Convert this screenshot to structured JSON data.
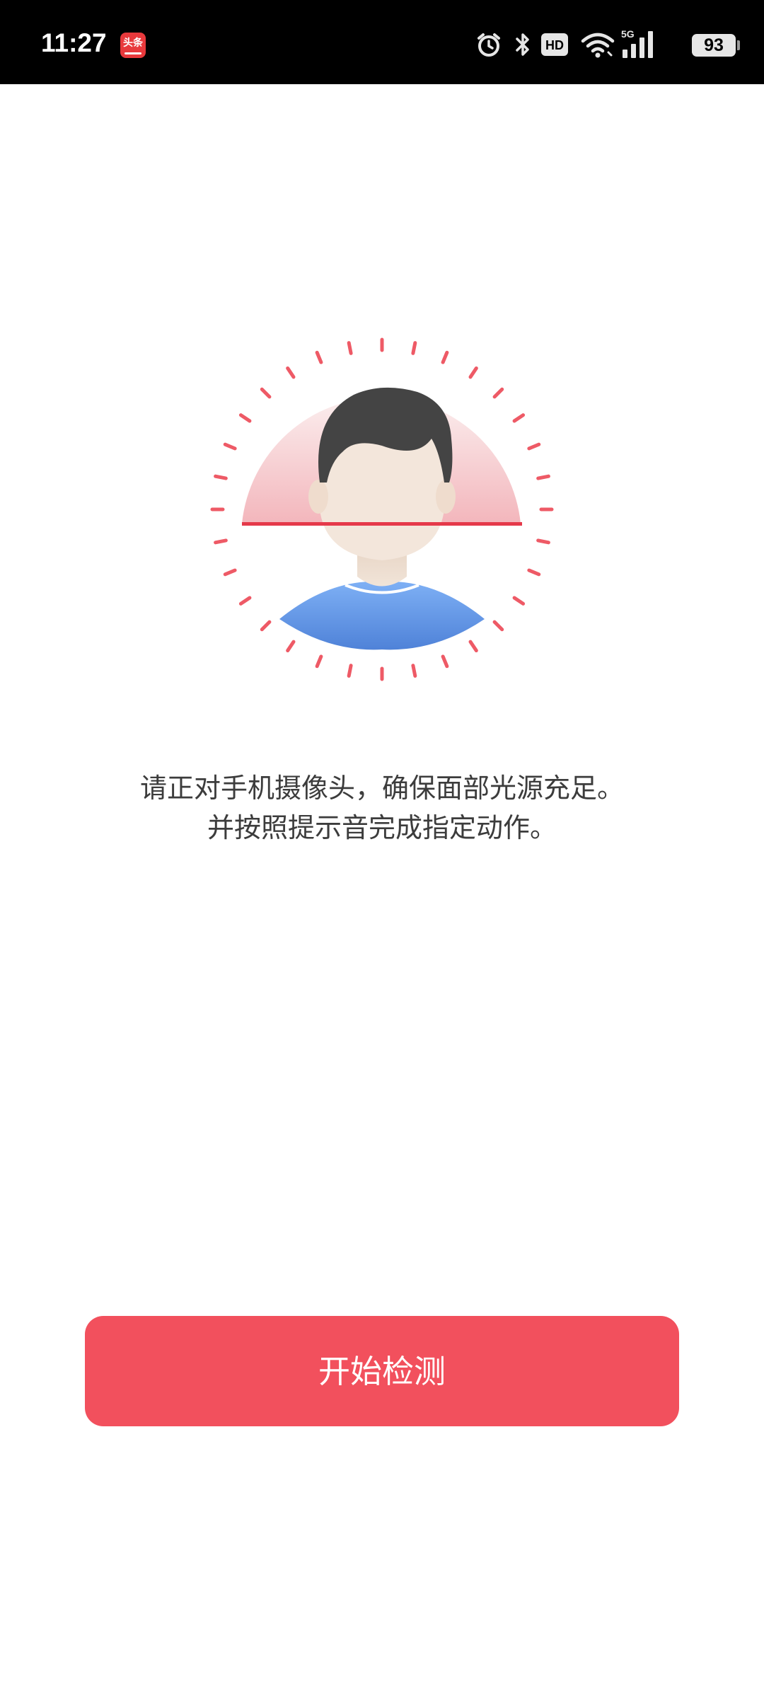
{
  "status_bar": {
    "time": "11:27",
    "app_badge": "头条",
    "battery": "93",
    "network": "5G",
    "hd_label": "HD",
    "icons": [
      "alarm-icon",
      "bluetooth-icon",
      "hd-icon",
      "wifi-icon",
      "signal-icon",
      "battery-icon"
    ]
  },
  "colors": {
    "accent": "#f2505d",
    "scan_line": "#e5394a",
    "shirt": "#5b8fe0",
    "hair": "#444444",
    "skin": "#f3e6db"
  },
  "instructions": {
    "line1": "请正对手机摄像头，确保面部光源充足。",
    "line2": "并按照提示音完成指定动作。"
  },
  "actions": {
    "start_label": "开始检测"
  }
}
